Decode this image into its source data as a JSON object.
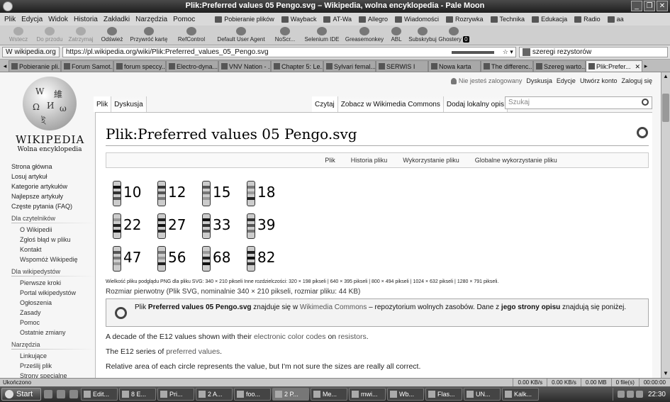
{
  "window": {
    "title": "Plik:Preferred values 05 Pengo.svg – Wikipedia, wolna encyklopedia - Pale Moon",
    "controls": [
      "_",
      "❐",
      "✕"
    ]
  },
  "menu": [
    "Plik",
    "Edycja",
    "Widok",
    "Historia",
    "Zakładki",
    "Narzędzia",
    "Pomoc"
  ],
  "bookmarks": [
    "Pobieranie plików",
    "Wayback",
    "AT-Wa",
    "Allegro",
    "Wiadomości",
    "Rozrywka",
    "Technika",
    "Edukacja",
    "Radio",
    "aa"
  ],
  "toolbar": {
    "back": "Wstecz",
    "forward": "Do przodu",
    "stop": "Zatrzymaj",
    "reload": "Odśwież",
    "restore": "Przywróć kartę",
    "refcontrol": "RefControl",
    "useragent": "Default User Agent",
    "noscript": "NoScr...",
    "selenium": "Selenium IDE",
    "greasemonkey": "Greasemonkey",
    "abl": "ABL",
    "subscribe": "Subskrybuj",
    "ghostery": "Ghostery",
    "ghostery_count": "0"
  },
  "address": {
    "site": "wikipedia.org",
    "url": "https://pl.wikipedia.org/wiki/Plik:Preferred_values_05_Pengo.svg",
    "search": "szeregi rezystorów"
  },
  "tabs": [
    "Pobieranie pli...",
    "Forum Samot...",
    "forum speccy...",
    "Electro-dyna...",
    "VNV Nation - ...",
    "Chapter 5: Le...",
    "Sylvari femal...",
    "SERWIS I",
    "Nowa karta",
    "The differenc...",
    "Szereg warto...",
    "Plik:Prefer..."
  ],
  "wiki": {
    "wordmark": "WIKIPEDIA",
    "tagline": "Wolna encyklopedia",
    "nav_main": [
      "Strona główna",
      "Losuj artykuł",
      "Kategorie artykułów",
      "Najlepsze artykuły",
      "Częste pytania (FAQ)"
    ],
    "readers_heading": "Dla czytelników",
    "readers": [
      "O Wikipedii",
      "Zgłoś błąd w pliku",
      "Kontakt",
      "Wspomóż Wikipedię"
    ],
    "editors_heading": "Dla wikipedystów",
    "editors": [
      "Pierwsze kroki",
      "Portal wikipedystów",
      "Ogłoszenia",
      "Zasady",
      "Pomoc",
      "Ostatnie zmiany"
    ],
    "tools_heading": "Narzędzia",
    "tools": [
      "Linkujące",
      "Prześlij plik",
      "Strony specjalne"
    ],
    "personal": {
      "not_logged": "Nie jesteś zalogowany",
      "discussion": "Dyskusja",
      "edits": "Edycje",
      "create": "Utwórz konto",
      "login": "Zaloguj się"
    },
    "ns_tabs": [
      "Plik",
      "Dyskusja"
    ],
    "view_tabs": [
      "Czytaj",
      "Zobacz w Wikimedia Commons",
      "Dodaj lokalny opis"
    ],
    "search_placeholder": "Szukaj",
    "page_title": "Plik:Preferred values 05 Pengo.svg",
    "file_toc": [
      "Plik",
      "Historia pliku",
      "Wykorzystanie pliku",
      "Globalne wykorzystanie pliku"
    ],
    "resistor_values": [
      "10",
      "12",
      "15",
      "18",
      "22",
      "27",
      "33",
      "39",
      "47",
      "56",
      "68",
      "82"
    ],
    "preview_info": "Wielkość pliku podglądu PNG dla pliku SVG: 340 × 210 pikseli Inne rozdzielczości: 320 × 198 pikseli | 640 × 395 pikseli | 800 × 494 pikseli | 1024 × 632 pikseli | 1280 × 791 pikseli.",
    "original_size": "Rozmiar pierwotny (Plik SVG, nominalnie 340 × 210 pikseli, rozmiar pliku: 44 KB)",
    "commons": {
      "pre": "Plik ",
      "file": "Preferred values 05 Pengo.svg",
      "mid": " znajduje się w ",
      "link": "Wikimedia Commons",
      "post": " – repozytorium wolnych zasobów. Dane z ",
      "bold2": "jego strony opisu",
      "end": " znajdują się poniżej."
    },
    "p1": {
      "a": "A decade of the E12 values shown with their ",
      "link1": "electronic color codes",
      "b": " on ",
      "link2": "resistors",
      "c": "."
    },
    "p2": {
      "a": "The E12 series of ",
      "link": "preferred values",
      "b": "."
    },
    "p3": "Relative area of each circle represents the value, but I'm not sure the sizes are really all correct."
  },
  "status": {
    "text": "Ukończono",
    "down": "0.00 KB/s",
    "up": "0.00 KB/s",
    "mb": "0.00 MB",
    "files": "0 file(s)",
    "time": "00:00:00"
  },
  "taskbar": {
    "start": "Start",
    "tasks": [
      "Edit...",
      "8 E...",
      "Pri...",
      "2 A...",
      "foo...",
      "2 P...",
      "Me...",
      "mwi...",
      "Wb...",
      "Flas...",
      "UN...",
      "Kalk..."
    ],
    "clock": "22:30"
  }
}
